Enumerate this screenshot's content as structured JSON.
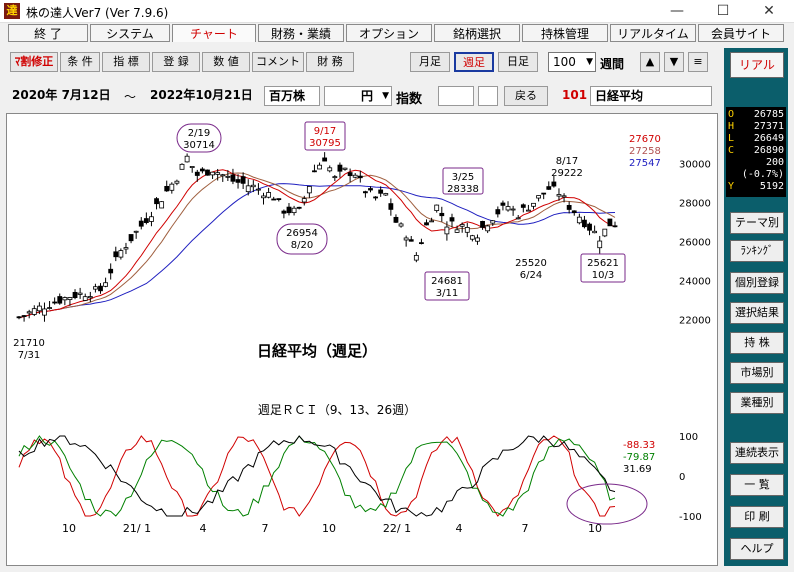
{
  "window": {
    "title": "株の達人Ver7 (Ver 7.9.6)",
    "app_icon": "達"
  },
  "menu": [
    "終 了",
    "システム",
    "チャート",
    "財務・業績",
    "オプション",
    "銘柄選択",
    "持株管理",
    "リアルタイム",
    "会員サイト"
  ],
  "toolbar": {
    "left": [
      "\u0018割修正",
      "条 件",
      "指 標",
      "登 録",
      "数 値",
      "コメント",
      "財 務"
    ],
    "period": [
      "月足",
      "週足",
      "日足"
    ],
    "count": "100",
    "unit": "週間",
    "arrows": [
      "▲",
      "▼",
      "≡"
    ]
  },
  "info": {
    "from": "2020年 7月12日",
    "tilde": "～",
    "to": "2022年10月21日",
    "unit1": "百万株",
    "unit2": "円",
    "index_label": "指数",
    "back": "戻る",
    "code": "101",
    "name": "日経平均"
  },
  "right": {
    "real": "リアル",
    "quote": {
      "O": "26785",
      "H": "27371",
      "L": "26649",
      "C": "26890",
      "change": "200",
      "pct": "(-0.7%)",
      "Y": "5192"
    },
    "buttons": [
      "テーマ別",
      "ﾗﾝｷﾝｸﾞ",
      "個別登録",
      "選択結果",
      "持 株",
      "市場別",
      "業種別",
      "連続表示",
      "一 覧",
      "印 刷",
      "ヘルプ"
    ]
  },
  "chart_data": {
    "type": "candlestick",
    "title": "日経平均（週足）",
    "yticks": [
      "30000",
      "28000",
      "26000",
      "24000",
      "22000"
    ],
    "ylim": [
      21000,
      31500
    ],
    "ma_values": [
      {
        "value": "27670",
        "color": "#d00000"
      },
      {
        "value": "27258",
        "color": "#b05050"
      },
      {
        "value": "27547",
        "color": "#2020c0"
      }
    ],
    "annotations": [
      {
        "top": "2/19",
        "bottom": "30714"
      },
      {
        "top": "9/17",
        "bottom": "30795"
      },
      {
        "top": "3/25",
        "bottom": "28338"
      },
      {
        "top": "8/17",
        "bottom": "29222"
      },
      {
        "top": "26954",
        "bottom": "8/20"
      },
      {
        "top": "24681",
        "bottom": "3/11"
      },
      {
        "top": "25520",
        "bottom": "6/24"
      },
      {
        "top": "25621",
        "bottom": "10/3"
      },
      {
        "top": "21710",
        "bottom": "7/31"
      }
    ],
    "x_labels": [
      "10",
      "21/ 1",
      "4",
      "7",
      "10",
      "22/ 1",
      "4",
      "7",
      "10"
    ],
    "rci": {
      "title": "週足ＲＣＩ（9、13、26週）",
      "yticks": [
        "100",
        "0",
        "-100"
      ],
      "values": [
        {
          "value": "-88.33",
          "color": "#d00000"
        },
        {
          "value": "-79.87",
          "color": "#008000"
        },
        {
          "value": "31.69",
          "color": "#000000"
        }
      ]
    }
  }
}
